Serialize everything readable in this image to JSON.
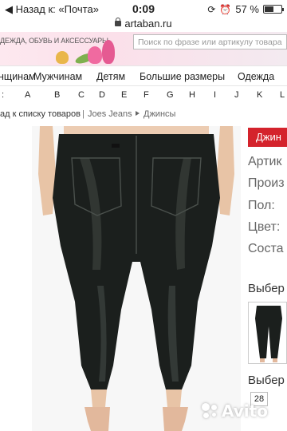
{
  "status_bar": {
    "back_label": "◀ Назад к: «Почта»",
    "time": "0:09",
    "battery_text": "57 %",
    "battery_level": 0.57
  },
  "browser": {
    "url": "artaban.ru"
  },
  "site": {
    "tagline": "ДЕЖДА, ОБУВЬ И АКСЕССУАРЫ",
    "search_placeholder": "Поиск по фразе или артикулу товара"
  },
  "nav": {
    "items": [
      "нщинам",
      "Мужчинам",
      "Детям",
      "Большие размеры",
      "Одежда"
    ]
  },
  "alphabet": {
    "items": [
      ":",
      "A",
      "B",
      "C",
      "D",
      "E",
      "F",
      "G",
      "H",
      "I",
      "J",
      "K",
      "L"
    ]
  },
  "breadcrumb": {
    "back": "ад к списку товаров",
    "separator": "|",
    "brand": "Joes Jeans",
    "category": "Джинсы"
  },
  "product": {
    "badge": "Джин",
    "fields": [
      "Артик",
      "Произ",
      "Пол: ",
      "Цвет:",
      "Соста"
    ],
    "select_color_label": "Выбер",
    "select_size_label": "Выбер",
    "size_option": "28"
  },
  "watermark": {
    "text": "Avito"
  },
  "colors": {
    "badge_red": "#d4232c",
    "jeans": "#1b1f1d",
    "skin": "#e8c4a6"
  }
}
